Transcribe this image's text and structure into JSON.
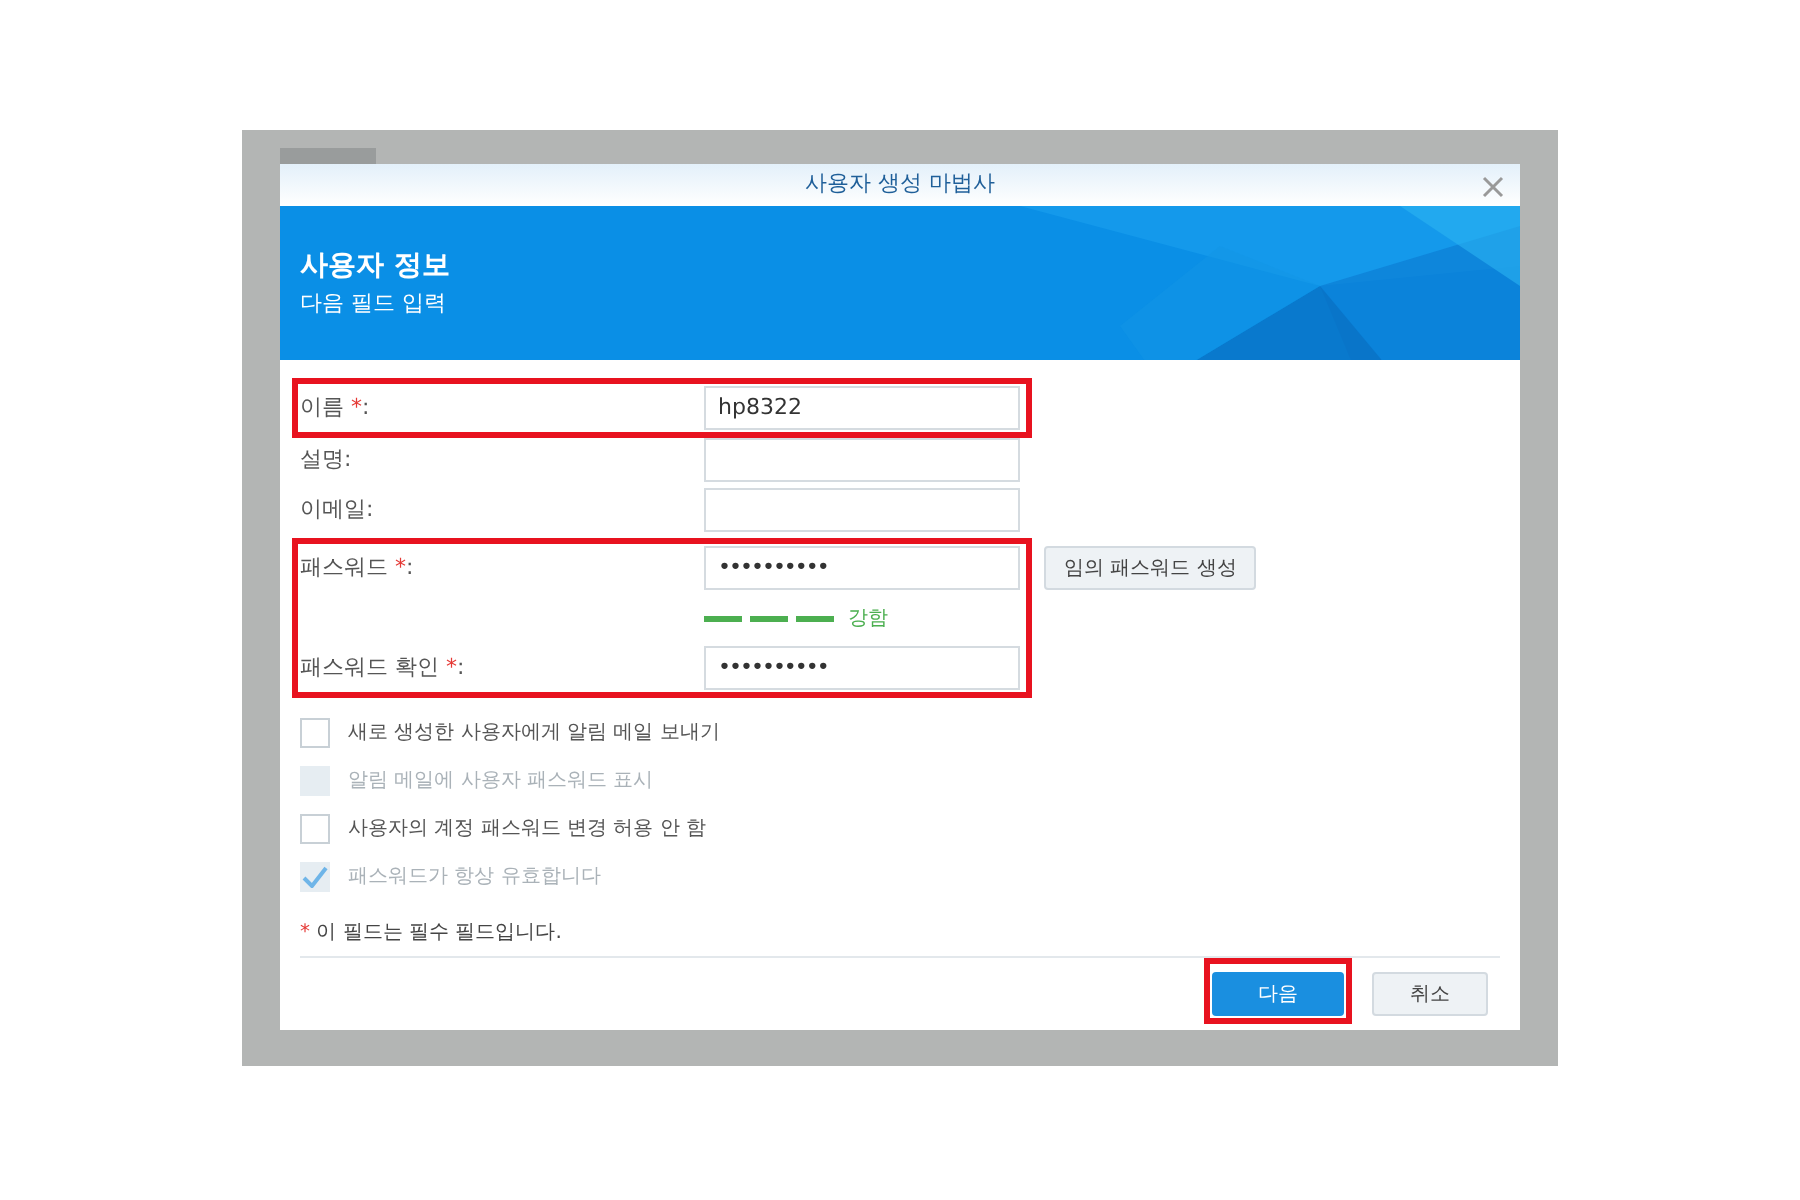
{
  "window": {
    "title": "사용자 생성 마법사"
  },
  "header": {
    "title": "사용자 정보",
    "subtitle": "다음 필드 입력"
  },
  "field_groups": [
    {
      "highlighted": true,
      "fields": [
        {
          "label": "이름",
          "required_mark": "*",
          "colon": ":",
          "value": "hp8322",
          "kind": "text"
        }
      ]
    },
    {
      "highlighted": false,
      "fields": [
        {
          "label": "설명",
          "colon": ":",
          "kind": "text"
        },
        {
          "label": "이메일",
          "colon": ":",
          "kind": "text"
        }
      ]
    },
    {
      "highlighted": true,
      "fields": [
        {
          "label": "패스워드",
          "required_mark": "*",
          "colon": ":",
          "value": "••••••••••",
          "kind": "password",
          "action_button": "임의 패스워드 생성",
          "strength": {
            "level": 1,
            "label": "강함"
          }
        },
        {
          "label": "패스워드 확인",
          "required_mark": "*",
          "colon": ":",
          "value": "••••••••••",
          "kind": "password"
        }
      ]
    }
  ],
  "options": [
    {
      "label": "새로 생성한 사용자에게 알림 메일 보내기",
      "checked": false,
      "disabled": false
    },
    {
      "label": "알림 메일에 사용자 패스워드 표시",
      "checked": false,
      "disabled": true
    },
    {
      "label": "사용자의 계정 패스워드 변경 허용 안 함",
      "checked": false,
      "disabled": false
    },
    {
      "label": "패스워드가 항상 유효합니다",
      "checked": true,
      "disabled": true
    }
  ],
  "required_note": {
    "mark": "*",
    "text": "이 필드는 필수 필드입니다."
  },
  "buttons": [
    {
      "label": "다음",
      "kind": "primary",
      "highlighted": true
    },
    {
      "label": "취소",
      "kind": "secondary",
      "highlighted": false
    }
  ]
}
